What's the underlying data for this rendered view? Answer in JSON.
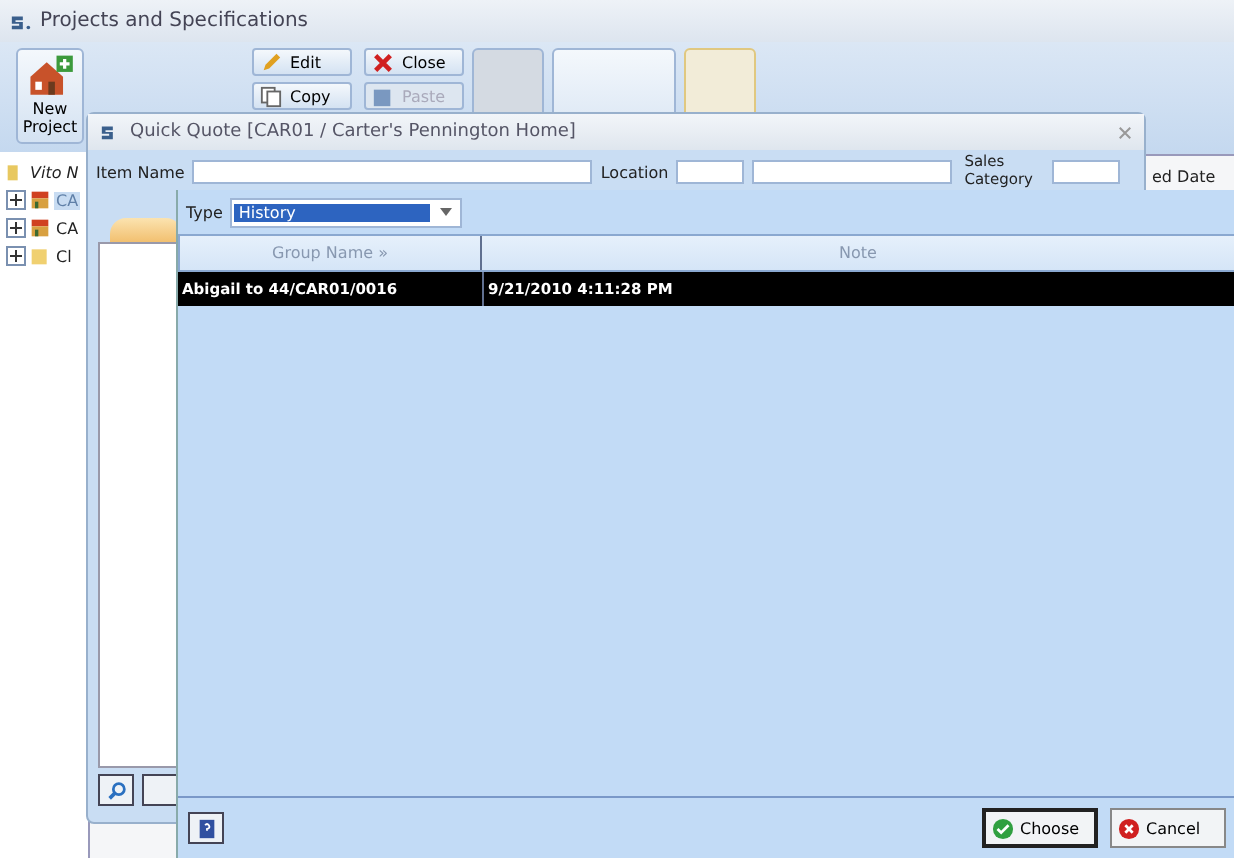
{
  "window": {
    "title": "Projects and Specifications"
  },
  "ribbon": {
    "big_buttons": [
      {
        "label": "New Project",
        "kind": "house"
      }
    ],
    "small_buttons": [
      {
        "label": "Edit",
        "disabled": false,
        "kind": "pencil"
      },
      {
        "label": "Close",
        "disabled": false,
        "kind": "cross"
      },
      {
        "label": "Copy",
        "disabled": false,
        "kind": "copy"
      },
      {
        "label": "Paste",
        "disabled": true,
        "kind": "paste"
      }
    ]
  },
  "tree": {
    "items": [
      {
        "label": "Vito N",
        "kind": "folder",
        "italic": true,
        "children": [
          {
            "label": "CA",
            "kind": "store",
            "selected": true
          },
          {
            "label": "CA",
            "kind": "store",
            "selected": false
          },
          {
            "label": "Cl",
            "kind": "folder",
            "selected": false
          }
        ]
      }
    ]
  },
  "behind_column": "ed Date",
  "dialog": {
    "title": "Quick Quote [CAR01 / Carter's Pennington Home]",
    "fields": [
      {
        "label": "Item Name"
      },
      {
        "label": "Location"
      },
      {
        "label": "Sales Category"
      }
    ],
    "type": {
      "label": "Type",
      "value": "History"
    },
    "table": {
      "columns": [
        "Group Name »",
        "Note"
      ],
      "rows": [
        {
          "cells": [
            "Abigail to  44/CAR01/0016",
            "9/21/2010 4:11:28 PM"
          ],
          "selected": true
        }
      ]
    },
    "buttons": [
      "Choose",
      "Cancel"
    ]
  }
}
